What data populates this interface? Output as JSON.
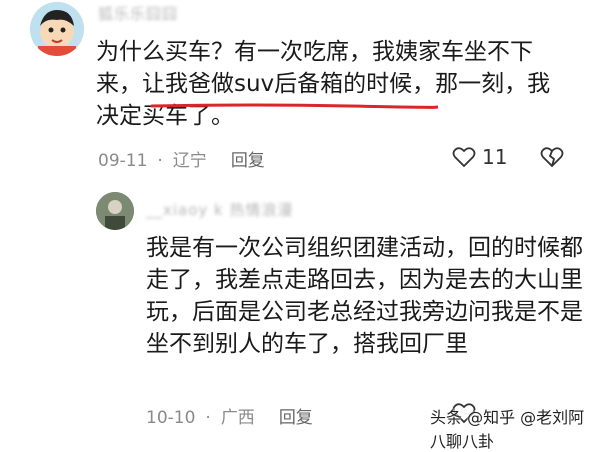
{
  "comment1": {
    "username": "狐乐乐囧囧",
    "text_before": "为什么买车？有一次吃席，我姨家车坐不下来，",
    "text_highlight": "让我爸做suv后备箱的时候",
    "text_after": "，那一刻，我决定买车了。",
    "date": "09-11",
    "location": "辽宁",
    "reply_label": "回复",
    "like_count": "11"
  },
  "comment2": {
    "username": "__xiaoy k 热情浪漫",
    "text": "我是有一次公司组织团建活动，回的时候都走了，我差点走路回去，因为是去的大山里玩，后面是公司老总经过我旁边问我是不是坐不到别人的车了，搭我回厂里",
    "date": "10-10",
    "location": "广西",
    "reply_label": "回复"
  },
  "watermark": {
    "text": "头条 @知乎 @老刘阿八聊八卦"
  },
  "colors": {
    "highlight_underline": "#d8262b",
    "meta_text": "#8a8a8a"
  }
}
